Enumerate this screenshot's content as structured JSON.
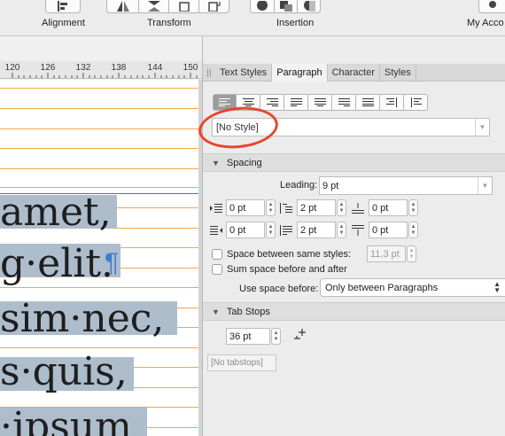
{
  "toolbar": {
    "alignment_label": "Alignment",
    "transform_label": "Transform",
    "insertion_label": "Insertion",
    "account_label": "My Acco"
  },
  "ruler": {
    "ticks": [
      "120",
      "126",
      "132",
      "138",
      "144",
      "150"
    ]
  },
  "document": {
    "lines": [
      "amet,",
      "g·elit.",
      "sim·nec,",
      "s·quis,",
      "·ipsum"
    ],
    "selection_color": "#aebdcc",
    "baseline_color": "#f4a64a"
  },
  "panel": {
    "tabs": [
      "Text Styles",
      "Paragraph",
      "Character",
      "Styles"
    ],
    "active_tab": "Paragraph",
    "paragraph_style": "[No Style]",
    "highlight_color": "#e8452f",
    "alignment_buttons": [
      "align-left",
      "align-center",
      "align-right",
      "justify-left",
      "justify-center",
      "justify-right",
      "justify-all",
      "align-towards-spine",
      "align-away-from-spine"
    ],
    "spacing": {
      "header": "Spacing",
      "leading_label": "Leading:",
      "leading_value": "9 pt",
      "left_indent": "0 pt",
      "first_line_indent": "2 pt",
      "space_before": "0 pt",
      "right_indent": "0 pt",
      "last_line_indent": "2 pt",
      "space_after": "0 pt",
      "same_styles_label": "Space between same styles:",
      "same_styles_value": "11,3 pt",
      "sum_label": "Sum space before and after",
      "use_before_label": "Use space before:",
      "use_before_value": "Only between Paragraphs"
    },
    "tab_stops": {
      "header": "Tab Stops",
      "default_value": "36 pt",
      "list_placeholder": "[No tabstops]"
    }
  }
}
